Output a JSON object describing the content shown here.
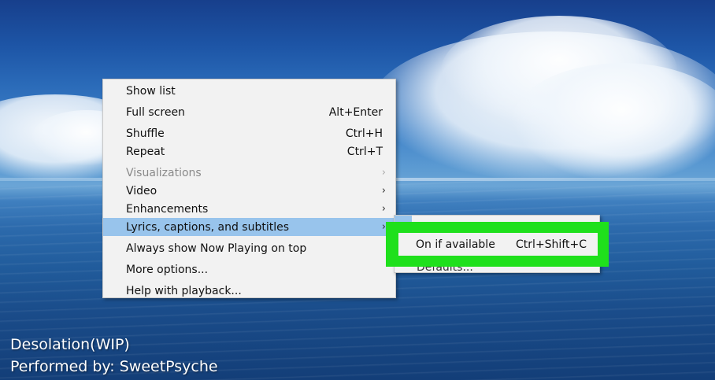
{
  "menu": {
    "items": [
      {
        "label": "Show list",
        "shortcut": "",
        "submenu": false,
        "disabled": false
      },
      {
        "label": "Full screen",
        "shortcut": "Alt+Enter",
        "submenu": false,
        "disabled": false
      },
      {
        "label": "Shuffle",
        "shortcut": "Ctrl+H",
        "submenu": false,
        "disabled": false
      },
      {
        "label": "Repeat",
        "shortcut": "Ctrl+T",
        "submenu": false,
        "disabled": false
      },
      {
        "label": "Visualizations",
        "shortcut": "",
        "submenu": true,
        "disabled": true
      },
      {
        "label": "Video",
        "shortcut": "",
        "submenu": true,
        "disabled": false
      },
      {
        "label": "Enhancements",
        "shortcut": "",
        "submenu": true,
        "disabled": false
      },
      {
        "label": "Lyrics, captions, and subtitles",
        "shortcut": "",
        "submenu": true,
        "disabled": false,
        "highlighted": true
      },
      {
        "label": "Always show Now Playing on top",
        "shortcut": "",
        "submenu": false,
        "disabled": false
      },
      {
        "label": "More options...",
        "shortcut": "",
        "submenu": false,
        "disabled": false
      },
      {
        "label": "Help with playback...",
        "shortcut": "",
        "submenu": false,
        "disabled": false
      }
    ],
    "arrow_glyph": "›"
  },
  "submenu": {
    "highlighted_item": {
      "label": "On if available",
      "shortcut": "Ctrl+Shift+C"
    },
    "partial_item_label": "Defaults..."
  },
  "overlay": {
    "track_title": "Desolation(WIP)",
    "artist_line": "Performed by: SweetPsyche"
  },
  "colors": {
    "menu_bg": "#f2f2f2",
    "menu_highlight": "#98c4ec",
    "annotation_green": "#1fe01c",
    "disabled_text": "#8a8a8a"
  }
}
